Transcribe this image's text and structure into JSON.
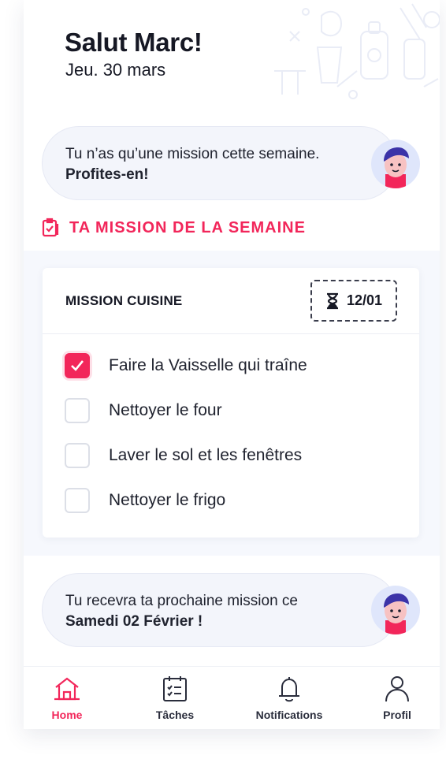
{
  "header": {
    "greeting": "Salut Marc!",
    "date": "Jeu. 30 mars"
  },
  "top_message": {
    "line1": "Tu n’as qu’une mission cette semaine.",
    "line2": "Profites-en!"
  },
  "section_title": "TA MISSION DE LA SEMAINE",
  "mission": {
    "title": "MISSION CUISINE",
    "deadline": "12/01",
    "tasks": [
      {
        "label": "Faire la Vaisselle qui traîne",
        "checked": true
      },
      {
        "label": "Nettoyer le four",
        "checked": false
      },
      {
        "label": "Laver le sol et les fenêtres",
        "checked": false
      },
      {
        "label": "Nettoyer le frigo",
        "checked": false
      }
    ]
  },
  "bottom_message": {
    "line1": "Tu recevra ta prochaine mission ce",
    "line2": "Samedi 02 Février !"
  },
  "nav": {
    "items": [
      {
        "label": "Home",
        "icon": "home-icon",
        "active": true
      },
      {
        "label": "Tâches",
        "icon": "task-list-icon",
        "active": false
      },
      {
        "label": "Notifications",
        "icon": "bell-icon",
        "active": false
      },
      {
        "label": "Profil",
        "icon": "user-icon",
        "active": false
      }
    ]
  },
  "colors": {
    "accent": "#f2265a",
    "text": "#161824",
    "background": "#f6f8fd",
    "bubble": "#f3f5fb"
  }
}
